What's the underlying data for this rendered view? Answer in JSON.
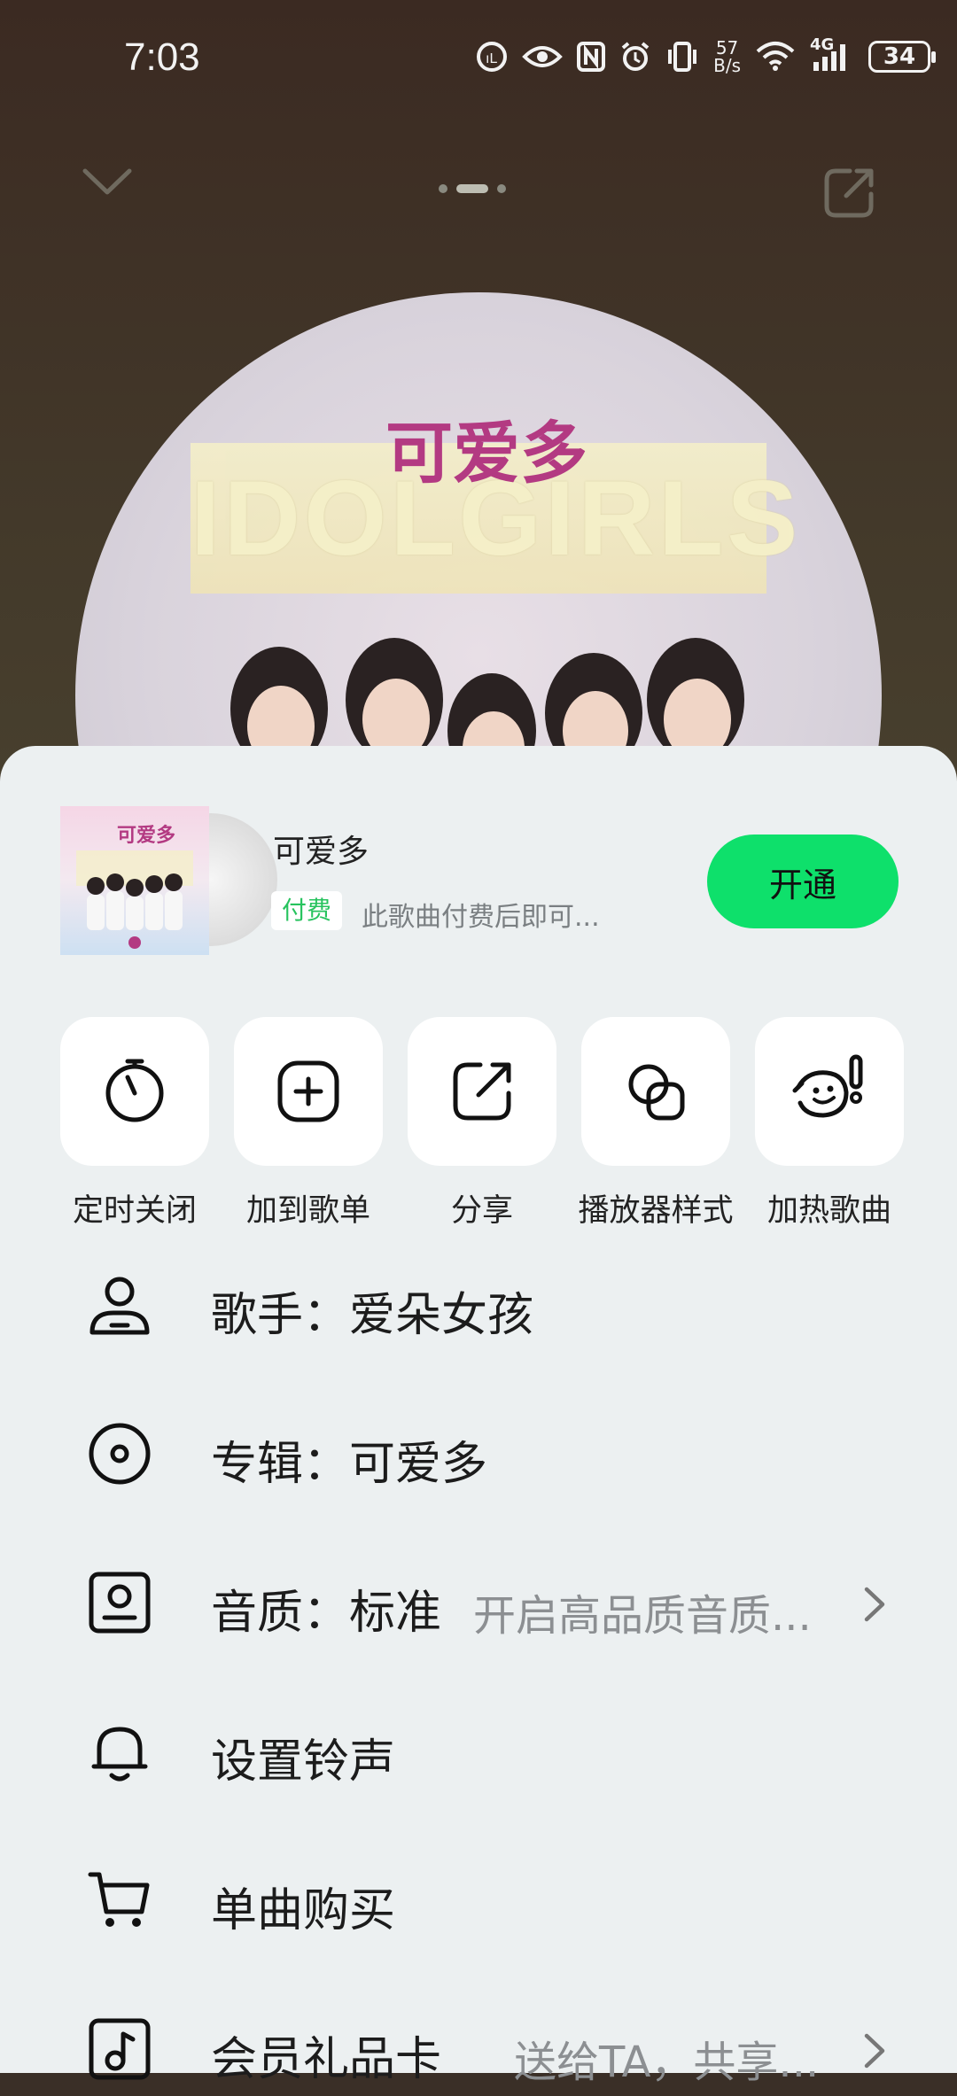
{
  "status_bar": {
    "time": "7:03",
    "net_speed_top": "57",
    "net_speed_bottom": "B/s",
    "network": "4G",
    "battery": "34",
    "icons": [
      "nfc-like-icon",
      "eye-icon",
      "nfc-icon",
      "alarm-icon",
      "vibrate-icon",
      "wifi-icon",
      "signal-icon",
      "battery-icon"
    ]
  },
  "player_header": {
    "collapse_icon": "chevron-down-icon",
    "share_icon": "share-icon",
    "page_indicator_count": 3,
    "page_indicator_active": 2
  },
  "album_art": {
    "logo_text": "可爱多",
    "banner_text": "IDOLGIRLS"
  },
  "song": {
    "title": "可爱多",
    "tag": "付费",
    "description": "此歌曲付费后即可...",
    "open_button": "开通",
    "accent_color": "#0ee06b"
  },
  "actions": [
    {
      "label": "定时关闭",
      "icon": "timer-icon"
    },
    {
      "label": "加到歌单",
      "icon": "add-to-playlist-icon"
    },
    {
      "label": "分享",
      "icon": "share-icon"
    },
    {
      "label": "播放器样式",
      "icon": "player-style-icon"
    },
    {
      "label": "加热歌曲",
      "icon": "boost-song-icon"
    }
  ],
  "menu": [
    {
      "label": "歌手：爱朵女孩",
      "icon": "artist-icon"
    },
    {
      "label": "专辑：可爱多",
      "icon": "album-icon"
    },
    {
      "label": "音质：标准",
      "sub": "开启高品质音质...",
      "icon": "quality-icon"
    },
    {
      "label": "设置铃声",
      "icon": "bell-icon"
    },
    {
      "label": "单曲购买",
      "icon": "cart-icon"
    },
    {
      "label": "会员礼品卡",
      "sub": "送给TA，共享...",
      "icon": "gift-card-icon"
    }
  ]
}
